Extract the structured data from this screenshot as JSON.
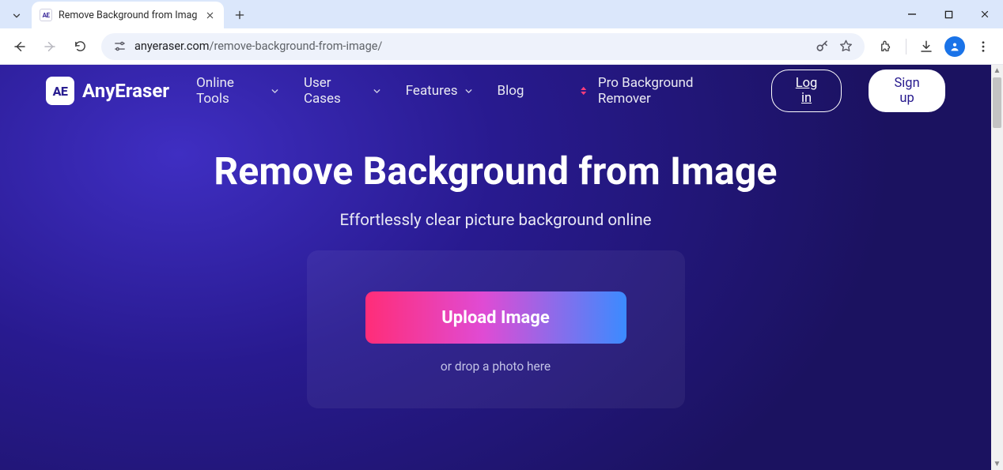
{
  "browser": {
    "tab_title": "Remove Background from Imag",
    "url_host": "anyeraser.com",
    "url_path": "/remove-background-from-image/"
  },
  "header": {
    "brand_mark": "AE",
    "brand_name": "AnyEraser",
    "nav": {
      "online_tools": "Online Tools",
      "user_cases": "User Cases",
      "features": "Features",
      "blog": "Blog",
      "pro": "Pro Background Remover"
    },
    "login_label": "Log in",
    "signup_label": "Sign up"
  },
  "hero": {
    "title": "Remove Background from Image",
    "subtitle": "Effortlessly clear picture background online"
  },
  "dropzone": {
    "upload_label": "Upload Image",
    "hint": "or drop a photo here"
  }
}
